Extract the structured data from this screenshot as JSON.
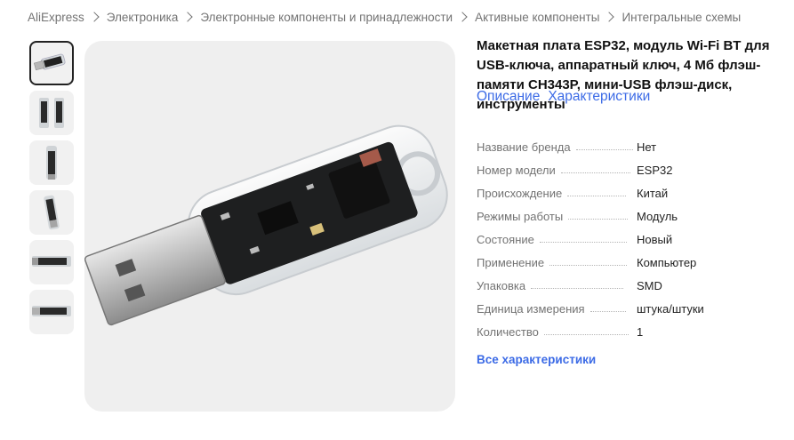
{
  "breadcrumb": [
    "AliExpress",
    "Электроника",
    "Электронные компоненты и принадлежности",
    "Активные компоненты",
    "Интегральные схемы"
  ],
  "product": {
    "title": "Макетная плата ESP32, модуль Wi-Fi BT для USB-ключа, аппаратный ключ, 4 Мб флэш-памяти CH343P, мини-USB флэш-диск, инструменты"
  },
  "tabs": [
    "Описание",
    "Характеристики"
  ],
  "specs": [
    {
      "key": "Название бренда",
      "value": "Нет"
    },
    {
      "key": "Номер модели",
      "value": "ESP32"
    },
    {
      "key": "Происхождение",
      "value": "Китай"
    },
    {
      "key": "Режимы работы",
      "value": "Модуль"
    },
    {
      "key": "Состояние",
      "value": "Новый"
    },
    {
      "key": "Применение",
      "value": "Компьютер"
    },
    {
      "key": "Упаковка",
      "value": "SMD"
    },
    {
      "key": "Единица измерения",
      "value": "штука/штуки"
    },
    {
      "key": "Количество",
      "value": "1"
    }
  ],
  "all_specs_link": "Все характеристики",
  "colors": {
    "accent": "#3c6be6",
    "muted": "#737373"
  }
}
